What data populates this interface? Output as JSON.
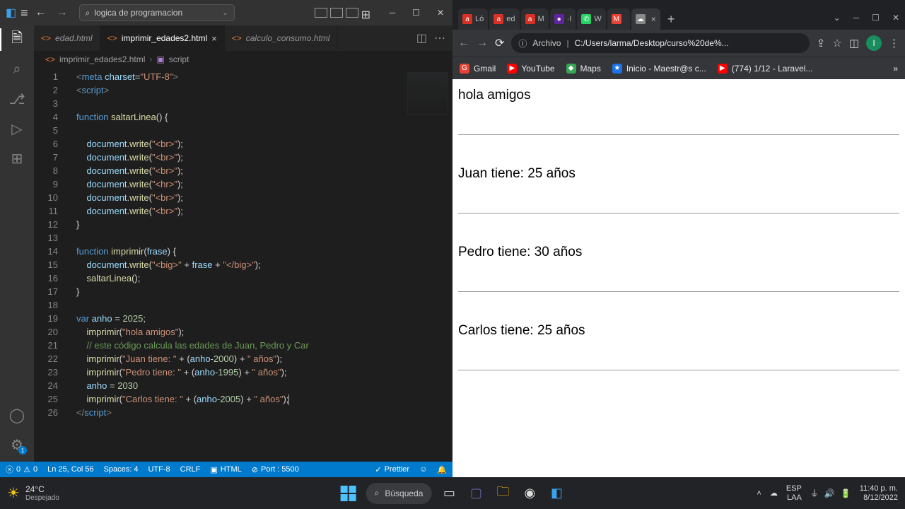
{
  "vscode": {
    "search_placeholder": "logica de programacion",
    "tabs": [
      {
        "name": "edad.html",
        "active": false
      },
      {
        "name": "imprimir_edades2.html",
        "active": true
      },
      {
        "name": "calculo_consumo.html",
        "active": false
      }
    ],
    "breadcrumb": {
      "file": "imprimir_edades2.html",
      "symbol": "script"
    },
    "code_lines": [
      {
        "n": 1,
        "html": "<span class='tk-tag'>&lt;</span><span class='tk-el'>meta</span> <span class='tk-attr'>charset</span><span class='tk-pn'>=</span><span class='tk-str'>\"UTF-8\"</span><span class='tk-tag'>&gt;</span>"
      },
      {
        "n": 2,
        "html": "<span class='tk-tag'>&lt;</span><span class='tk-el'>script</span><span class='tk-tag'>&gt;</span>"
      },
      {
        "n": 3,
        "html": ""
      },
      {
        "n": 4,
        "html": "<span class='tk-kw'>function</span> <span class='tk-fn'>saltarLinea</span><span class='tk-pn'>() {</span>"
      },
      {
        "n": 5,
        "html": ""
      },
      {
        "n": 6,
        "html": "    <span class='tk-var'>document</span><span class='tk-pn'>.</span><span class='tk-fn'>write</span><span class='tk-pn'>(</span><span class='tk-str'>\"&lt;br&gt;\"</span><span class='tk-pn'>);</span>"
      },
      {
        "n": 7,
        "html": "    <span class='tk-var'>document</span><span class='tk-pn'>.</span><span class='tk-fn'>write</span><span class='tk-pn'>(</span><span class='tk-str'>\"&lt;br&gt;\"</span><span class='tk-pn'>);</span>"
      },
      {
        "n": 8,
        "html": "    <span class='tk-var'>document</span><span class='tk-pn'>.</span><span class='tk-fn'>write</span><span class='tk-pn'>(</span><span class='tk-str'>\"&lt;br&gt;\"</span><span class='tk-pn'>);</span>"
      },
      {
        "n": 9,
        "html": "    <span class='tk-var'>document</span><span class='tk-pn'>.</span><span class='tk-fn'>write</span><span class='tk-pn'>(</span><span class='tk-str'>\"&lt;hr&gt;\"</span><span class='tk-pn'>);</span>"
      },
      {
        "n": 10,
        "html": "    <span class='tk-var'>document</span><span class='tk-pn'>.</span><span class='tk-fn'>write</span><span class='tk-pn'>(</span><span class='tk-str'>\"&lt;br&gt;\"</span><span class='tk-pn'>);</span>"
      },
      {
        "n": 11,
        "html": "    <span class='tk-var'>document</span><span class='tk-pn'>.</span><span class='tk-fn'>write</span><span class='tk-pn'>(</span><span class='tk-str'>\"&lt;br&gt;\"</span><span class='tk-pn'>);</span>"
      },
      {
        "n": 12,
        "html": "<span class='tk-pn'>}</span>"
      },
      {
        "n": 13,
        "html": ""
      },
      {
        "n": 14,
        "html": "<span class='tk-kw'>function</span> <span class='tk-fn'>imprimir</span><span class='tk-pn'>(</span><span class='tk-var'>frase</span><span class='tk-pn'>) {</span>"
      },
      {
        "n": 15,
        "html": "    <span class='tk-var'>document</span><span class='tk-pn'>.</span><span class='tk-fn'>write</span><span class='tk-pn'>(</span><span class='tk-str'>\"&lt;big&gt;\"</span> <span class='tk-op'>+</span> <span class='tk-var'>frase</span> <span class='tk-op'>+</span> <span class='tk-str'>\"&lt;/big&gt;\"</span><span class='tk-pn'>);</span>"
      },
      {
        "n": 16,
        "html": "    <span class='tk-fn'>saltarLinea</span><span class='tk-pn'>();</span>"
      },
      {
        "n": 17,
        "html": "<span class='tk-pn'>}</span>"
      },
      {
        "n": 18,
        "html": ""
      },
      {
        "n": 19,
        "html": "<span class='tk-kw'>var</span> <span class='tk-var'>anho</span> <span class='tk-op'>=</span> <span class='tk-num'>2025</span><span class='tk-pn'>;</span>"
      },
      {
        "n": 20,
        "html": "    <span class='tk-fn'>imprimir</span><span class='tk-pn'>(</span><span class='tk-str'>\"hola amigos\"</span><span class='tk-pn'>);</span>"
      },
      {
        "n": 21,
        "html": "    <span class='tk-cm'>// este código calcula las edades de Juan, Pedro y Car</span>"
      },
      {
        "n": 22,
        "html": "    <span class='tk-fn'>imprimir</span><span class='tk-pn'>(</span><span class='tk-str'>\"Juan tiene: \"</span> <span class='tk-op'>+</span> <span class='tk-pn'>(</span><span class='tk-var'>anho</span><span class='tk-op'>-</span><span class='tk-num'>2000</span><span class='tk-pn'>)</span> <span class='tk-op'>+</span> <span class='tk-str'>\" años\"</span><span class='tk-pn'>);</span>"
      },
      {
        "n": 23,
        "html": "    <span class='tk-fn'>imprimir</span><span class='tk-pn'>(</span><span class='tk-str'>\"Pedro tiene: \"</span> <span class='tk-op'>+</span> <span class='tk-pn'>(</span><span class='tk-var'>anho</span><span class='tk-op'>-</span><span class='tk-num'>1995</span><span class='tk-pn'>)</span> <span class='tk-op'>+</span> <span class='tk-str'>\" años\"</span><span class='tk-pn'>);</span>"
      },
      {
        "n": 24,
        "html": "    <span class='tk-var'>anho</span> <span class='tk-op'>=</span> <span class='tk-num'>2030</span>"
      },
      {
        "n": 25,
        "html": "    <span class='tk-fn'>imprimir</span><span class='tk-pn'>(</span><span class='tk-str'>\"Carlos tiene: \"</span> <span class='tk-op'>+</span> <span class='tk-pn'>(</span><span class='tk-var'>anho</span><span class='tk-op'>-</span><span class='tk-num'>2005</span><span class='tk-pn'>)</span> <span class='tk-op'>+</span> <span class='tk-str'>\" años\"</span><span class='tk-pn'>);</span><span class='cursor-bar'></span>"
      },
      {
        "n": 26,
        "html": "<span class='tk-tag'>&lt;/</span><span class='tk-el'>script</span><span class='tk-tag'>&gt;</span>"
      }
    ],
    "statusbar": {
      "errors": "0",
      "warnings": "0",
      "position": "Ln 25, Col 56",
      "spaces": "Spaces: 4",
      "encoding": "UTF-8",
      "eol": "CRLF",
      "lang": "HTML",
      "port": "Port : 5500",
      "prettier": "Prettier"
    }
  },
  "chrome": {
    "tabs": [
      {
        "icon_bg": "#d93025",
        "icon_txt": "a",
        "label": "Ló"
      },
      {
        "icon_bg": "#d93025",
        "icon_txt": "a",
        "label": "ed"
      },
      {
        "icon_bg": "#d93025",
        "icon_txt": "a",
        "label": "M"
      },
      {
        "icon_bg": "#5f259f",
        "icon_txt": "●",
        "label": "·I"
      },
      {
        "icon_bg": "#25d366",
        "icon_txt": "✆",
        "label": "W"
      },
      {
        "icon_bg": "#ea4335",
        "icon_txt": "M",
        "label": ""
      },
      {
        "icon_bg": "#888",
        "icon_txt": "☁",
        "label": "",
        "active": true
      }
    ],
    "address": {
      "prefix": "Archivo",
      "path": "C:/Users/larma/Desktop/curso%20de%..."
    },
    "bookmarks": [
      {
        "label": "Gmail",
        "color": "#ea4335",
        "glyph": "G"
      },
      {
        "label": "YouTube",
        "color": "#ff0000",
        "glyph": "▶"
      },
      {
        "label": "Maps",
        "color": "#34a853",
        "glyph": "◆"
      },
      {
        "label": "Inicio - Maestr@s c...",
        "color": "#1a73e8",
        "glyph": "★"
      },
      {
        "label": "(774) 1/12 - Laravel...",
        "color": "#ff0000",
        "glyph": "▶"
      }
    ],
    "page_output": [
      "hola amigos",
      "Juan tiene: 25 años",
      "Pedro tiene: 30 años",
      "Carlos tiene: 25 años"
    ]
  },
  "taskbar": {
    "weather_temp": "24°C",
    "weather_desc": "Despejado",
    "search": "Búsqueda",
    "lang1": "ESP",
    "lang2": "LAA",
    "time": "11:40 p. m.",
    "date": "8/12/2022"
  }
}
